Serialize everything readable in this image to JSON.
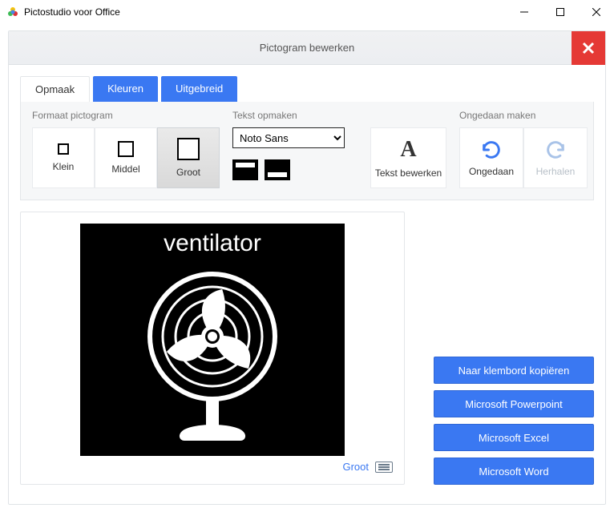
{
  "window": {
    "title": "Pictostudio voor Office"
  },
  "panel": {
    "title": "Pictogram bewerken"
  },
  "tabs": {
    "opmaak": "Opmaak",
    "kleuren": "Kleuren",
    "uitgebreid": "Uitgebreid"
  },
  "groups": {
    "format_label": "Formaat pictogram",
    "text_label": "Tekst opmaken",
    "undo_label": "Ongedaan maken"
  },
  "sizes": {
    "klein": "Klein",
    "middel": "Middel",
    "groot": "Groot"
  },
  "font": {
    "selected": "Noto Sans"
  },
  "buttons": {
    "tekst_bewerken": "Tekst bewerken",
    "ongedaan": "Ongedaan",
    "herhalen": "Herhalen"
  },
  "preview": {
    "pictogram_label": "ventilator",
    "footer_size": "Groot"
  },
  "actions": {
    "copy": "Naar klembord kopiëren",
    "powerpoint": "Microsoft Powerpoint",
    "excel": "Microsoft Excel",
    "word": "Microsoft Word"
  }
}
